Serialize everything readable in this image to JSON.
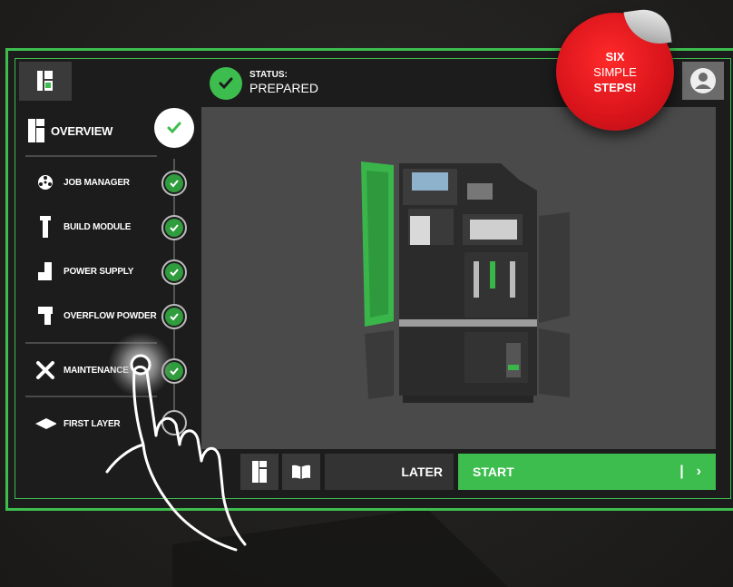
{
  "header": {
    "status_label": "STATUS:",
    "status_value": "PREPARED"
  },
  "sidebar": {
    "overview_label": "OVERVIEW",
    "steps": [
      {
        "label": "JOB MANAGER",
        "icon": "film-reel-icon",
        "done": true
      },
      {
        "label": "BUILD MODULE",
        "icon": "build-module-icon",
        "done": true
      },
      {
        "label": "POWER SUPPLY",
        "icon": "power-supply-icon",
        "done": true
      },
      {
        "label": "OVERFLOW POWDER",
        "icon": "overflow-powder-icon",
        "done": true
      },
      {
        "label": "MAINTENANCE",
        "icon": "tools-icon",
        "done": true
      },
      {
        "label": "FIRST LAYER",
        "icon": "layer-icon",
        "done": false
      }
    ]
  },
  "actions": {
    "later_label": "LATER",
    "start_label": "START",
    "start_separator": "|",
    "start_arrow": "›"
  },
  "sticker": {
    "line1": "SIX",
    "line2": "SIMPLE",
    "line3": "STEPS!"
  },
  "colors": {
    "accent": "#3ebd4f",
    "sticker_red": "#d8141b",
    "panel": "#1c1c1c"
  }
}
